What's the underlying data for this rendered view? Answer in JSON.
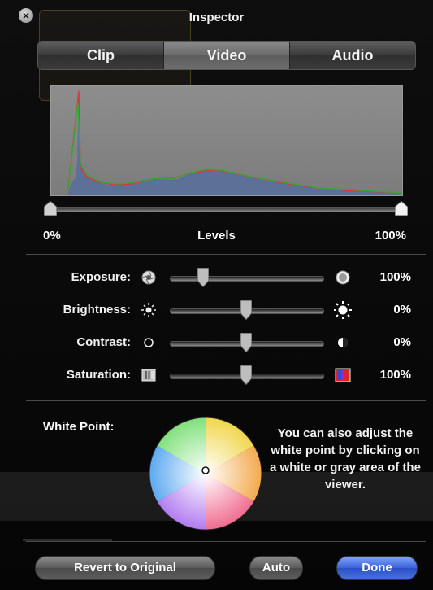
{
  "window": {
    "title": "Inspector"
  },
  "tabs": [
    {
      "label": "Clip",
      "active": false
    },
    {
      "label": "Video",
      "active": true
    },
    {
      "label": "Audio",
      "active": false
    }
  ],
  "levels": {
    "label": "Levels",
    "min_label": "0%",
    "max_label": "100%"
  },
  "adjustments": {
    "exposure": {
      "label": "Exposure:",
      "value": "100%",
      "level": 0.22,
      "icon_left": "aperture-closed-icon",
      "icon_right": "aperture-open-icon"
    },
    "brightness": {
      "label": "Brightness:",
      "value": "0%",
      "level": 0.5,
      "icon_left": "sun-small-icon",
      "icon_right": "sun-large-icon"
    },
    "contrast": {
      "label": "Contrast:",
      "value": "0%",
      "level": 0.5,
      "icon_left": "circle-outline-icon",
      "icon_right": "half-circle-icon"
    },
    "saturation": {
      "label": "Saturation:",
      "value": "100%",
      "level": 0.5,
      "icon_left": "grayscale-swatch-icon",
      "icon_right": "color-swatch-icon"
    }
  },
  "white_point": {
    "label": "White Point:",
    "help_text": "You can also adjust the white point by clicking on a white or gray area of the viewer."
  },
  "buttons": {
    "revert": "Revert to Original",
    "auto": "Auto",
    "done": "Done"
  },
  "colors": {
    "done_button": "#3c63d8",
    "panel_bg": "#0a0a0a",
    "histogram_bg": "#8a8a8a"
  }
}
